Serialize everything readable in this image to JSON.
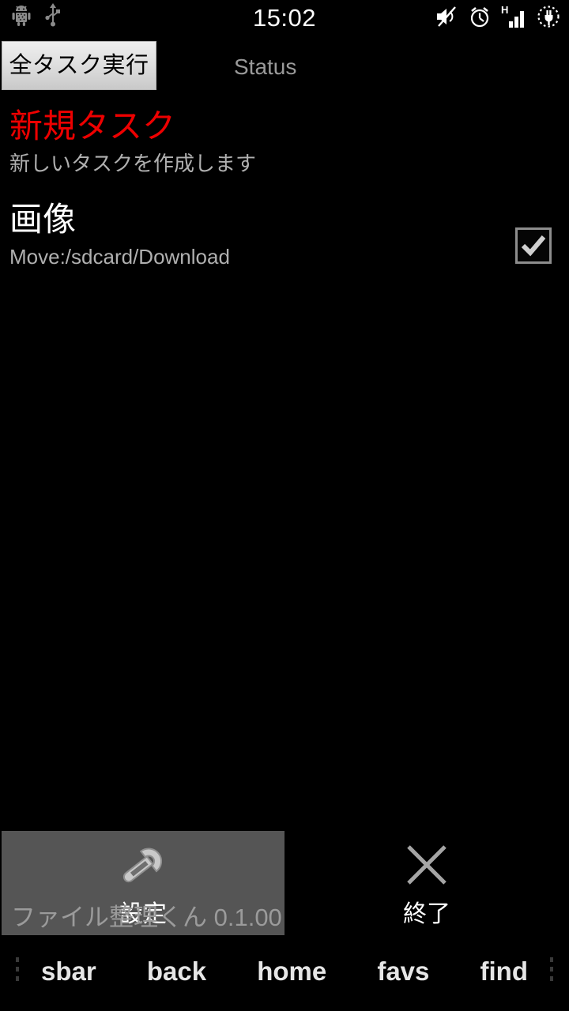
{
  "statusbar": {
    "time": "15:02",
    "left_icons": [
      {
        "name": "android-debug-icon"
      },
      {
        "name": "usb-icon"
      }
    ],
    "right_icons": [
      {
        "name": "volume-mute-icon"
      },
      {
        "name": "alarm-clock-icon"
      },
      {
        "name": "signal-bars-h-icon",
        "network": "H"
      },
      {
        "name": "battery-charging-icon"
      }
    ]
  },
  "actionbar": {
    "run_all_label": "全タスク実行",
    "status_label": "Status"
  },
  "tasks": [
    {
      "title": "新規タスク",
      "subtitle": "新しいタスクを作成します",
      "title_color": "#ee0000",
      "checkbox": false
    },
    {
      "title": "画像",
      "subtitle": "Move:/sdcard/Download",
      "title_color": "#ffffff",
      "checkbox": true
    }
  ],
  "options": {
    "settings_label": "設定",
    "settings_icon": "wrench-icon",
    "exit_label": "終了",
    "exit_icon": "close-x-icon"
  },
  "app": {
    "version_line": "ファイル整理くん 0.1.00"
  },
  "navbar": {
    "items": [
      {
        "label": "sbar"
      },
      {
        "label": "back"
      },
      {
        "label": "home"
      },
      {
        "label": "favs"
      },
      {
        "label": "find"
      }
    ]
  }
}
